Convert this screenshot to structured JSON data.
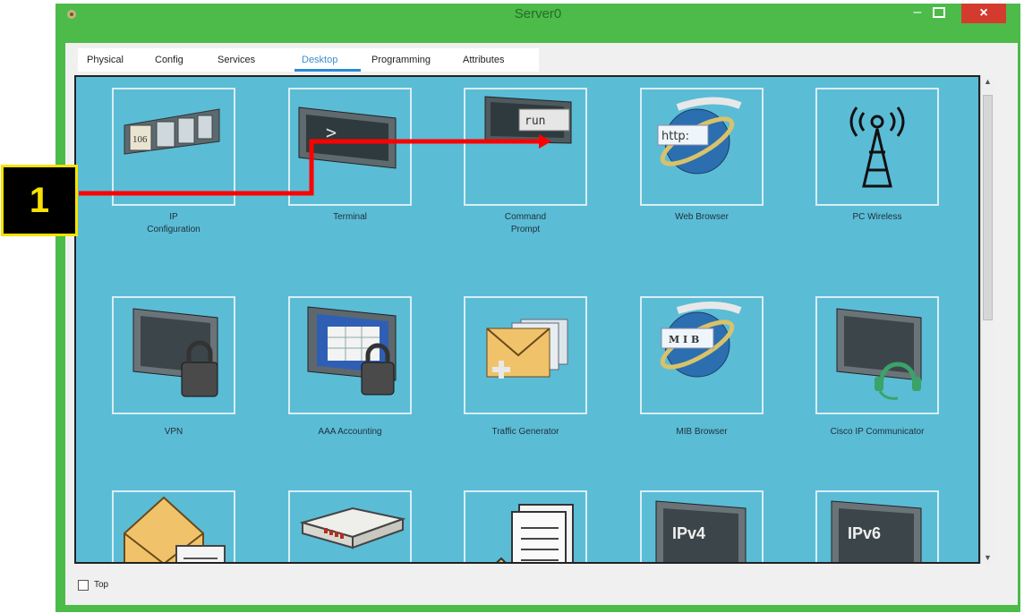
{
  "window": {
    "title": "Server0",
    "close_glyph": "×",
    "minimize_glyph": "–"
  },
  "tabs": [
    {
      "label": "Physical",
      "active": false
    },
    {
      "label": "Config",
      "active": false
    },
    {
      "label": "Services",
      "active": false
    },
    {
      "label": "Desktop",
      "active": true
    },
    {
      "label": "Programming",
      "active": false
    },
    {
      "label": "Attributes",
      "active": false
    }
  ],
  "desktop_apps": {
    "ip_config": {
      "label_line1": "IP",
      "label_line2": "Configuration",
      "icon": "ip-config-icon",
      "icon_text": "106"
    },
    "terminal": {
      "label": "Terminal",
      "icon": "terminal-icon",
      "icon_text": ">"
    },
    "command_prompt": {
      "label_line1": "Command",
      "label_line2": "Prompt",
      "icon": "command-prompt-icon",
      "icon_text": "run"
    },
    "web_browser": {
      "label": "Web Browser",
      "icon": "web-browser-icon",
      "icon_text": "http:"
    },
    "pc_wireless": {
      "label": "PC Wireless",
      "icon": "wireless-tower-icon"
    },
    "vpn": {
      "label": "VPN",
      "icon": "vpn-lock-icon"
    },
    "aaa_accounting": {
      "label": "AAA Accounting",
      "icon": "aaa-accounting-icon"
    },
    "traffic_generator": {
      "label": "Traffic Generator",
      "icon": "traffic-generator-icon"
    },
    "mib_browser": {
      "label": "MIB Browser",
      "icon": "mib-browser-icon",
      "icon_text": "M I B"
    },
    "cisco_ip_communicator": {
      "label": "Cisco IP Communicator",
      "icon": "ip-communicator-icon"
    },
    "email": {
      "icon": "email-icon"
    },
    "pppoe_dialer": {
      "icon": "pppoe-dialer-icon"
    },
    "text_editor": {
      "icon": "text-editor-icon"
    },
    "ipv4_firewall": {
      "icon": "ipv4-firewall-icon",
      "icon_text": "IPv4"
    },
    "ipv6_firewall": {
      "icon": "ipv6-firewall-icon",
      "icon_text": "IPv6"
    }
  },
  "footer": {
    "top_checkbox_label": "Top",
    "top_checked": false
  },
  "callout": {
    "number": "1"
  },
  "colors": {
    "window_frame": "#4cbb4a",
    "desktop_bg": "#5bbcd6",
    "active_tab": "#3a8fd0",
    "close_button": "#d43b2f",
    "annotation_arrow": "#ff0000",
    "callout_text": "#f7e200"
  }
}
